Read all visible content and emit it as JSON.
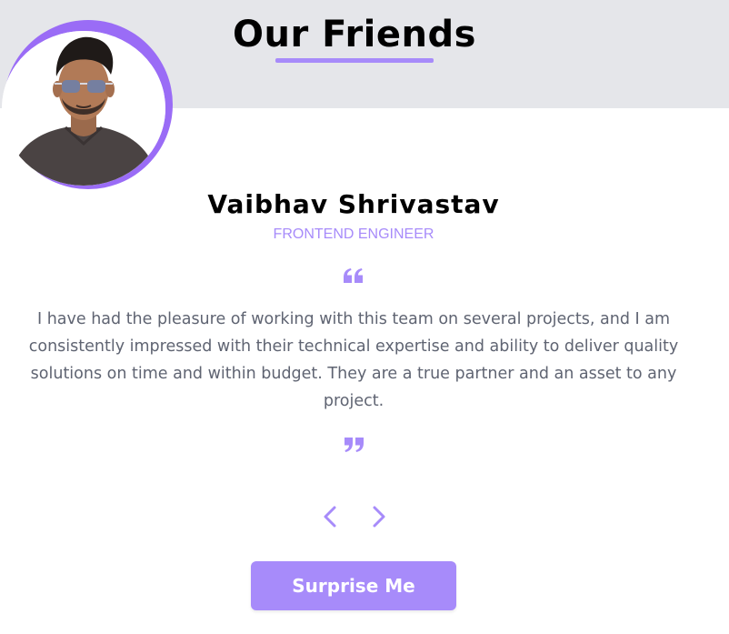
{
  "header": {
    "title": "Our Friends"
  },
  "testimonial": {
    "name": "Vaibhav Shrivastav",
    "role": "FRONTEND ENGINEER",
    "text": "I have had the pleasure of working with this team on several projects, and I am consistently impressed with their technical expertise and ability to deliver quality solutions on time and within budget. They are a true partner and an asset to any project.",
    "quote_open_icon": "quote-left-icon",
    "quote_close_icon": "quote-right-icon"
  },
  "navigation": {
    "prev_icon": "chevron-left-icon",
    "next_icon": "chevron-right-icon"
  },
  "actions": {
    "surprise_label": "Surprise Me"
  },
  "colors": {
    "accent": "#a78bfa",
    "ring": "#9a6cf6",
    "header_band": "#e5e6ea",
    "text_body": "#5f6472"
  }
}
